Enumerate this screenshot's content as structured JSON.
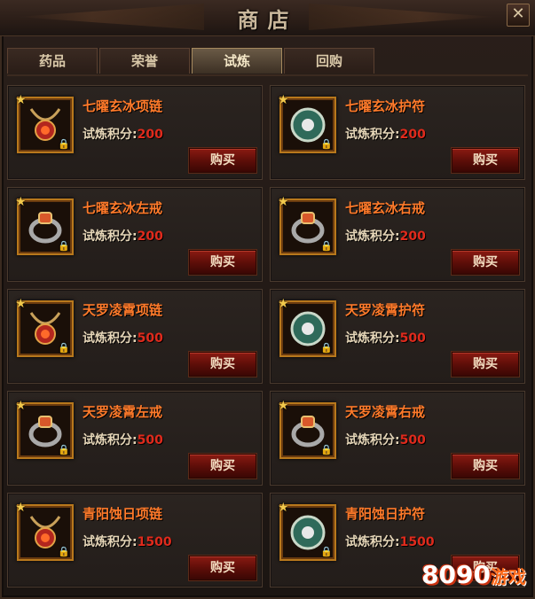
{
  "window": {
    "title": "商店",
    "close_label": "✕"
  },
  "tabs": [
    {
      "label": "药品",
      "active": false
    },
    {
      "label": "荣誉",
      "active": false
    },
    {
      "label": "试炼",
      "active": true
    },
    {
      "label": "回购",
      "active": false
    }
  ],
  "items": [
    {
      "name": "七曜玄冰项链",
      "price_label": "试炼积分:",
      "price": "200",
      "buy_label": "购买",
      "icon": "necklace-icon"
    },
    {
      "name": "七曜玄冰护符",
      "price_label": "试炼积分:",
      "price": "200",
      "buy_label": "购买",
      "icon": "amulet-icon"
    },
    {
      "name": "七曜玄冰左戒",
      "price_label": "试炼积分:",
      "price": "200",
      "buy_label": "购买",
      "icon": "ring-icon"
    },
    {
      "name": "七曜玄冰右戒",
      "price_label": "试炼积分:",
      "price": "200",
      "buy_label": "购买",
      "icon": "ring-icon"
    },
    {
      "name": "天罗凌霄项链",
      "price_label": "试炼积分:",
      "price": "500",
      "buy_label": "购买",
      "icon": "necklace-icon"
    },
    {
      "name": "天罗凌霄护符",
      "price_label": "试炼积分:",
      "price": "500",
      "buy_label": "购买",
      "icon": "amulet-icon"
    },
    {
      "name": "天罗凌霄左戒",
      "price_label": "试炼积分:",
      "price": "500",
      "buy_label": "购买",
      "icon": "ring-icon"
    },
    {
      "name": "天罗凌霄右戒",
      "price_label": "试炼积分:",
      "price": "500",
      "buy_label": "购买",
      "icon": "ring-icon"
    },
    {
      "name": "青阳蚀日项链",
      "price_label": "试炼积分:",
      "price": "1500",
      "buy_label": "购买",
      "icon": "necklace-icon"
    },
    {
      "name": "青阳蚀日护符",
      "price_label": "试炼积分:",
      "price": "1500",
      "buy_label": "购买",
      "icon": "amulet-icon"
    }
  ],
  "watermark": {
    "text1": "8090",
    "text2": "游戏"
  },
  "colors": {
    "item_name": "#ff7a2a",
    "price_value": "#e02a1c",
    "accent_gold": "#b8781c"
  }
}
